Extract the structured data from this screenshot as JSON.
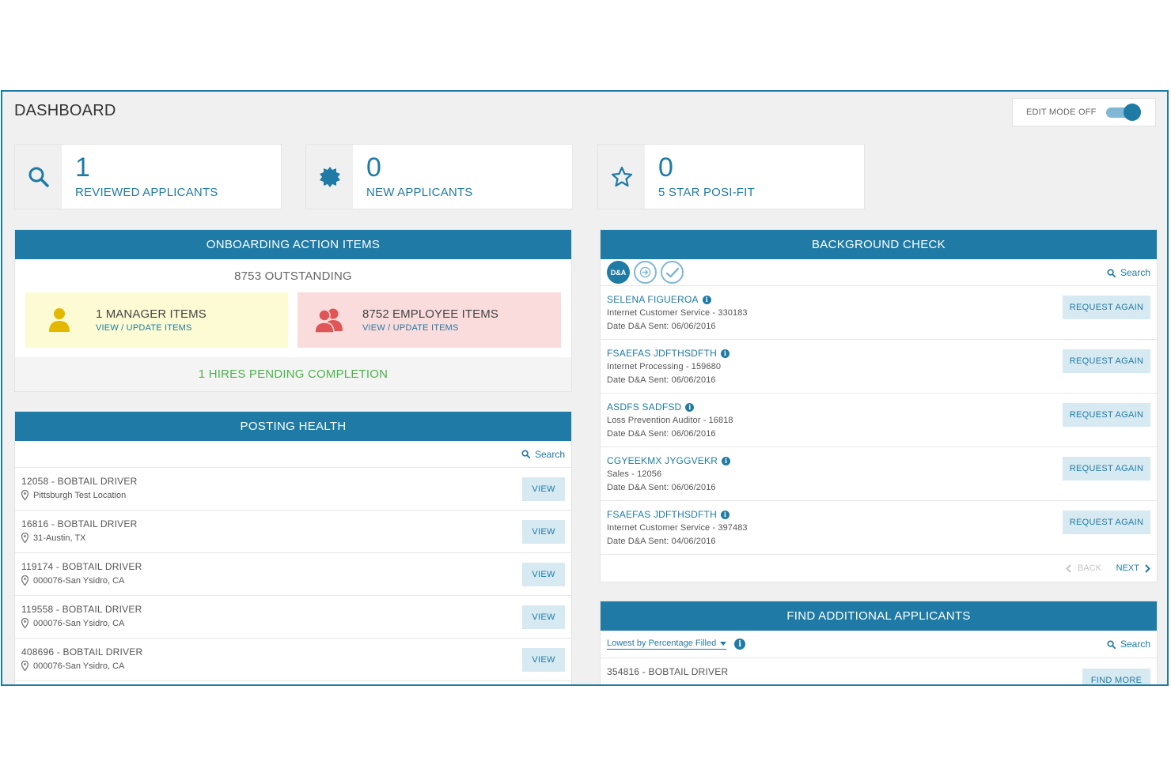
{
  "header": {
    "title": "DASHBOARD",
    "edit_mode_label": "EDIT MODE OFF"
  },
  "stats": [
    {
      "icon": "search-icon",
      "value": "1",
      "label": "REVIEWED APPLICANTS"
    },
    {
      "icon": "badge-icon",
      "value": "0",
      "label": "NEW APPLICANTS"
    },
    {
      "icon": "star-icon",
      "value": "0",
      "label": "5 STAR POSI-FIT"
    }
  ],
  "onboarding": {
    "title": "ONBOARDING ACTION ITEMS",
    "outstanding": "8753 OUTSTANDING",
    "manager": {
      "title": "1 MANAGER ITEMS",
      "link": "VIEW / UPDATE ITEMS"
    },
    "employee": {
      "title": "8752 EMPLOYEE ITEMS",
      "link": "VIEW / UPDATE ITEMS"
    },
    "hires_pending": "1 HIRES PENDING COMPLETION"
  },
  "posting_health": {
    "title": "POSTING HEALTH",
    "search_label": "Search",
    "view_label": "VIEW",
    "rows": [
      {
        "title": "12058 - BOBTAIL DRIVER",
        "location": "Pittsburgh Test Location"
      },
      {
        "title": "16816 - BOBTAIL DRIVER",
        "location": "31-Austin, TX"
      },
      {
        "title": "119174 - BOBTAIL DRIVER",
        "location": "000076-San Ysidro, CA"
      },
      {
        "title": "119558 - BOBTAIL DRIVER",
        "location": "000076-San Ysidro, CA"
      },
      {
        "title": "408696 - BOBTAIL DRIVER",
        "location": "000076-San Ysidro, CA"
      }
    ]
  },
  "background_check": {
    "title": "BACKGROUND CHECK",
    "search_label": "Search",
    "tab_da_label": "D&A",
    "request_label": "REQUEST AGAIN",
    "back_label": "BACK",
    "next_label": "NEXT",
    "rows": [
      {
        "name": "SELENA FIGUEROA",
        "job": "Internet Customer Service - 330183",
        "date": "Date D&A Sent: 06/06/2016"
      },
      {
        "name": "FSAEFAS JDFTHSDFTH",
        "job": "Internet Processing - 159680",
        "date": "Date D&A Sent: 06/06/2016"
      },
      {
        "name": "ASDFS SADFSD",
        "job": "Loss Prevention Auditor - 16818",
        "date": "Date D&A Sent: 06/06/2016"
      },
      {
        "name": "CGYEEKMX JYGGVEKR",
        "job": "Sales - 12056",
        "date": "Date D&A Sent: 06/06/2016"
      },
      {
        "name": "FSAEFAS JDFTHSDFTH",
        "job": "Internet Customer Service - 397483",
        "date": "Date D&A Sent: 04/06/2016"
      }
    ]
  },
  "find_applicants": {
    "title": "FIND ADDITIONAL APPLICANTS",
    "sort_label": "Lowest by Percentage Filled",
    "search_label": "Search",
    "rows": [
      {
        "title": "354816 - BOBTAIL DRIVER",
        "button": "FIND MORE"
      }
    ]
  },
  "colors": {
    "primary": "#1f7ba5",
    "success": "#4bb34b",
    "manager_bg": "#fdfbd3",
    "employee_bg": "#fbdcdc",
    "manager_icon": "#e5b800",
    "employee_icon": "#e05555"
  }
}
